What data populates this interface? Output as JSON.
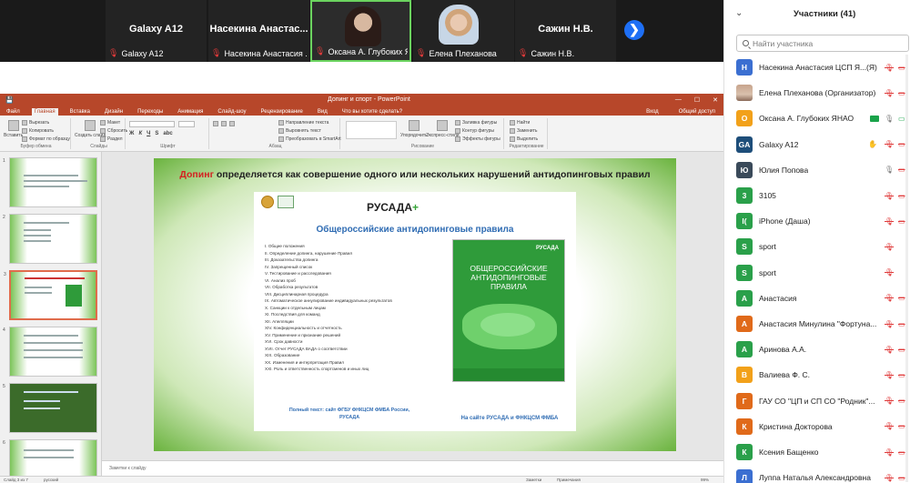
{
  "video_strip": {
    "tiles": [
      {
        "name": "Galaxy A12",
        "label": "Galaxy A12"
      },
      {
        "name": "Насекина Анастас...",
        "label": "Насекина Анастасия ..."
      },
      {
        "name": "",
        "label": "Оксана А. Глубоких ЯН..."
      },
      {
        "name": "",
        "label": "Елена Плеханова"
      },
      {
        "name": "Сажин Н.В.",
        "label": "Сажин Н.В."
      }
    ],
    "raise_hand_glyph": "✋",
    "next_glyph": "❯"
  },
  "powerpoint": {
    "window_title": "Допинг и спорт - PowerPoint",
    "menu": [
      "Файл",
      "Главная",
      "Вставка",
      "Дизайн",
      "Переходы",
      "Анимация",
      "Слайд-шоу",
      "Рецензирование",
      "Вид",
      "Что вы хотите сделать?"
    ],
    "menu_right": [
      "Вход",
      "Общий доступ"
    ],
    "ribbon": {
      "paste": "Вставить",
      "cut": "Вырезать",
      "copy": "Копировать",
      "format_painter": "Формат по образцу",
      "clipboard_group": "Буфер обмена",
      "new_slide": "Создать слайд",
      "layout": "Макет",
      "reset": "Сбросить",
      "section": "Раздел",
      "slides_group": "Слайды",
      "font_group": "Шрифт",
      "paragraph_group": "Абзац",
      "text_direction": "Направление текста",
      "align_text": "Выровнять текст",
      "convert_smartart": "Преобразовать в SmartArt",
      "arrange": "Упорядочить",
      "quick_styles": "Экспресс-стили",
      "drawing_group": "Рисование",
      "shape_fill": "Заливка фигуры",
      "shape_outline": "Контур фигуры",
      "shape_effects": "Эффекты фигуры",
      "find": "Найти",
      "replace": "Заменить",
      "select": "Выделить",
      "editing_group": "Редактирование"
    },
    "thumbnails": [
      "1",
      "2",
      "3",
      "4",
      "5",
      "6"
    ],
    "slide": {
      "heading_red": "Допинг",
      "heading_rest": "определяется как совершение одного или нескольких нарушений антидопинговых правил",
      "rusada": "РУСАДА",
      "panel_title": "Общероссийские антидопинговые правила",
      "rules": [
        "I.     Общие положения",
        "II. Определение допинга, нарушение Правил",
        "III.  Доказательства допинга",
        "IV.  Запрещенный список",
        "V.  Тестирование и расследования",
        "VI.  Анализ проб",
        "VII.  Обработка результатов",
        "VIII.  Дисциплинарная процедура",
        "IX.  Автоматическое аннулирование индивидуальных результатов",
        "X.  Санкции к отдельным лицам",
        "XI.  Последствия для команд",
        "XII.  Апелляции",
        "XIV.  Конфиденциальность и отчетность",
        "XV.  Применение и признание решений",
        "XVI.  Срок давности",
        "XVII.  Отчет РУСАДА ВАДА о соответствии",
        "XIX.  Образование",
        "XX.  Изменения и интерпретация Правил",
        "XXI.  Роль и ответственность спортсменов и иных лиц"
      ],
      "full_text": "Полный текст: сайт ФГБУ ФНКЦСМ ФМБА России, РУСАДА",
      "book_logo": "РУСАДА",
      "book_title": "ОБЩЕРОССИЙСКИЕ АНТИДОПИНГОВЫЕ ПРАВИЛА",
      "site_caption": "На сайте РУСАДА и ФНКЦСМ ФМБА"
    },
    "notes_placeholder": "Заметки к слайду",
    "status": {
      "slide_count": "Слайд 3 из 7",
      "language": "русский",
      "notes": "Заметки",
      "comments": "Примечания",
      "zoom": "99%"
    }
  },
  "participants": {
    "title": "Участники (41)",
    "search_placeholder": "Найти участника",
    "list": [
      {
        "initial": "Н",
        "color": "#3b6fd1",
        "name": "Насекина Анастасия ЦСП Я...",
        "suffix": "(Я)",
        "mic": "off",
        "cam": "off"
      },
      {
        "initial": "",
        "color": "",
        "photo": true,
        "name": "Елена Плеханова (Организатор)",
        "mic": "off",
        "cam": "off"
      },
      {
        "initial": "О",
        "color": "#f2a11a",
        "name": "Оксана А. Глубоких ЯНАО",
        "mic": "share",
        "cam": "on"
      },
      {
        "initial": "GA",
        "color": "#1e4e7a",
        "name": "Galaxy A12",
        "mic": "hand",
        "cam": "off"
      },
      {
        "initial": "Ю",
        "color": "#3a4a5a",
        "name": "Юлия Попова",
        "mic": "on",
        "cam": "off"
      },
      {
        "initial": "3",
        "color": "#2aa04a",
        "name": "3105",
        "mic": "off",
        "cam": "off"
      },
      {
        "initial": "I(",
        "color": "#2aa04a",
        "name": "iPhone (Даша)",
        "mic": "off",
        "cam": "off"
      },
      {
        "initial": "S",
        "color": "#2aa04a",
        "name": "sport",
        "mic": "off",
        "cam": ""
      },
      {
        "initial": "S",
        "color": "#2aa04a",
        "name": "sport",
        "mic": "off",
        "cam": ""
      },
      {
        "initial": "А",
        "color": "#2aa04a",
        "name": "Анастасия",
        "mic": "off",
        "cam": "off"
      },
      {
        "initial": "А",
        "color": "#e06a1a",
        "name": "Анастасия Минулина \"Фортуна...",
        "mic": "off",
        "cam": "off"
      },
      {
        "initial": "А",
        "color": "#2aa04a",
        "name": "Аринова А.А.",
        "mic": "off",
        "cam": "off"
      },
      {
        "initial": "В",
        "color": "#f2a11a",
        "name": "Валиева Ф. С.",
        "mic": "off",
        "cam": "off"
      },
      {
        "initial": "Г",
        "color": "#e06a1a",
        "name": "ГАУ СО \"ЦП и СП СО \"Родник\"...",
        "mic": "off",
        "cam": "off"
      },
      {
        "initial": "К",
        "color": "#e06a1a",
        "name": "Кристина Докторова",
        "mic": "off",
        "cam": "off"
      },
      {
        "initial": "К",
        "color": "#2aa04a",
        "name": "Ксения Бащенко",
        "mic": "off",
        "cam": "off"
      },
      {
        "initial": "Л",
        "color": "#3b6fd1",
        "name": "Луппа Наталья Александровна",
        "mic": "off",
        "cam": "off"
      }
    ]
  }
}
